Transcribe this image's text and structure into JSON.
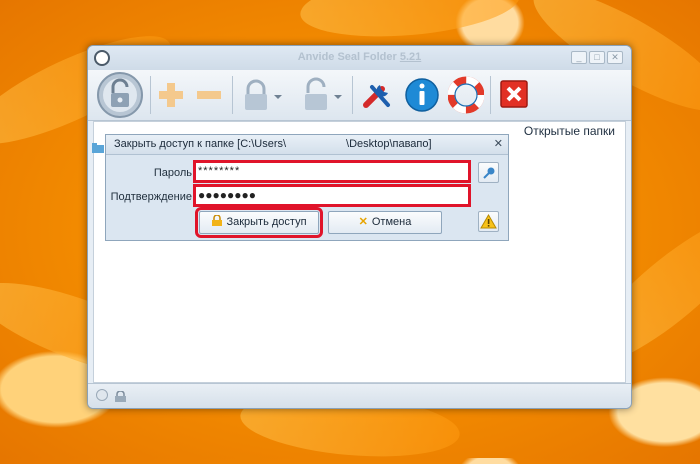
{
  "window": {
    "app_name": "Anvide Seal Folder",
    "version": "5.21"
  },
  "toolbar": {
    "buttons": [
      "lock-main-icon",
      "add-icon",
      "remove-icon",
      "lock-closed-icon",
      "lock-open-icon",
      "settings-icon",
      "info-icon",
      "help-icon",
      "exit-icon"
    ]
  },
  "panel": {
    "header": "Открытые папки"
  },
  "dialog": {
    "title_prefix": "Закрыть доступ к папке [C:\\Users\\",
    "title_suffix": "\\Desktop\\павапо]",
    "close": "✕",
    "password_label": "Пароль",
    "password_value": "********",
    "confirm_label": "Подтверждение",
    "confirm_value": "●●●●●●●●",
    "lock_button": "Закрыть доступ",
    "cancel_button": "Отмена"
  },
  "colors": {
    "highlight": "#e0142a",
    "accent": "#1e8ad6"
  }
}
